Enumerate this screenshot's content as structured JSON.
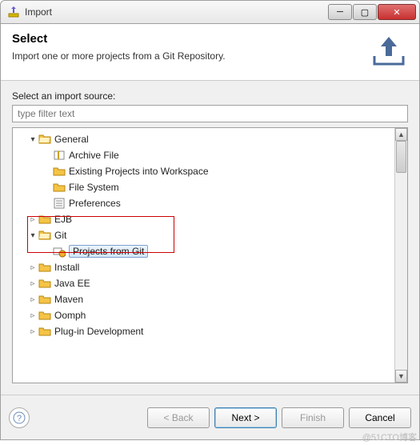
{
  "window": {
    "title": "Import"
  },
  "header": {
    "heading": "Select",
    "desc": "Import one or more projects from a Git Repository."
  },
  "filter": {
    "label": "Select an import source:",
    "placeholder": "type filter text"
  },
  "tree": {
    "general": {
      "label": "General",
      "archive": "Archive File",
      "existing": "Existing Projects into Workspace",
      "filesystem": "File System",
      "prefs": "Preferences"
    },
    "ejb": "EJB",
    "git": {
      "label": "Git",
      "projects": "Projects from Git"
    },
    "install": "Install",
    "javaee": "Java EE",
    "maven": "Maven",
    "oomph": "Oomph",
    "plugin": "Plug-in Development"
  },
  "buttons": {
    "back": "< Back",
    "next": "Next >",
    "finish": "Finish",
    "cancel": "Cancel"
  },
  "watermark": "@51CTO博客"
}
